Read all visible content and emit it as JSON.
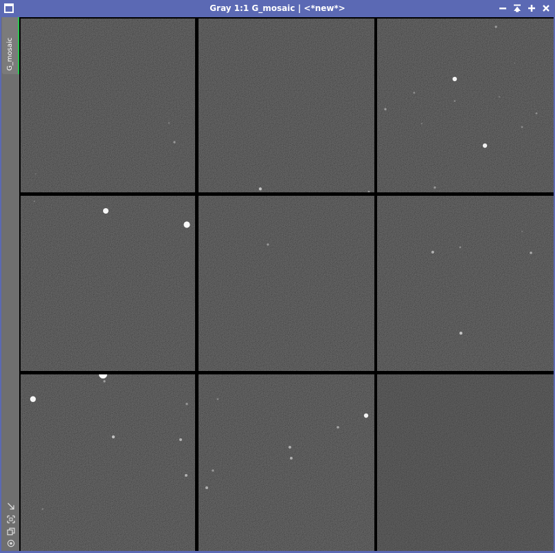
{
  "window": {
    "title": "Gray 1:1 G_mosaic | <*new*>",
    "accent_color": "#5b69b4",
    "controls": [
      "minimize-icon",
      "shade-icon",
      "maximize-icon",
      "close-icon"
    ]
  },
  "sidebar": {
    "tab_label": "G_mosaic",
    "tab_indicator_color": "#2bc450",
    "tools": [
      "resize-arrow-icon",
      "fit-view-icon",
      "clone-icon",
      "identifier-icon"
    ]
  },
  "image": {
    "mosaic_grid": "3x3",
    "background": "#000000"
  }
}
